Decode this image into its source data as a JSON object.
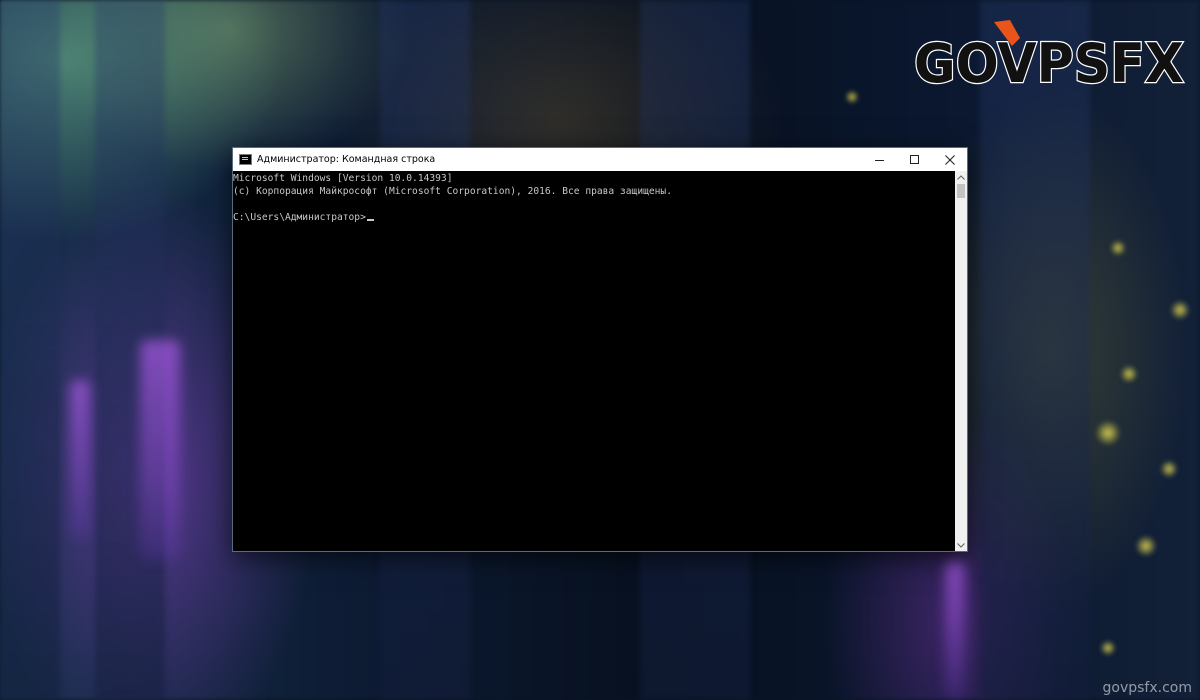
{
  "window": {
    "title": "Администратор: Командная строка",
    "controls": {
      "minimize": "minimize-icon",
      "maximize": "maximize-icon",
      "close": "close-icon"
    }
  },
  "console": {
    "lines": [
      "Microsoft Windows [Version 10.0.14393]",
      "(c) Корпорация Майкрософт (Microsoft Corporation), 2016. Все права защищены.",
      "",
      "C:\\Users\\Администратор>"
    ]
  },
  "logo": {
    "text": "GOVPSFX",
    "colors": {
      "fill": "#111111",
      "outline": "#ffffff",
      "accent": "#e8541a"
    }
  },
  "watermark": "govpsfx.com",
  "colors": {
    "console_bg": "#000000",
    "console_text": "#c8c8c8",
    "titlebar_bg": "#ffffff"
  }
}
